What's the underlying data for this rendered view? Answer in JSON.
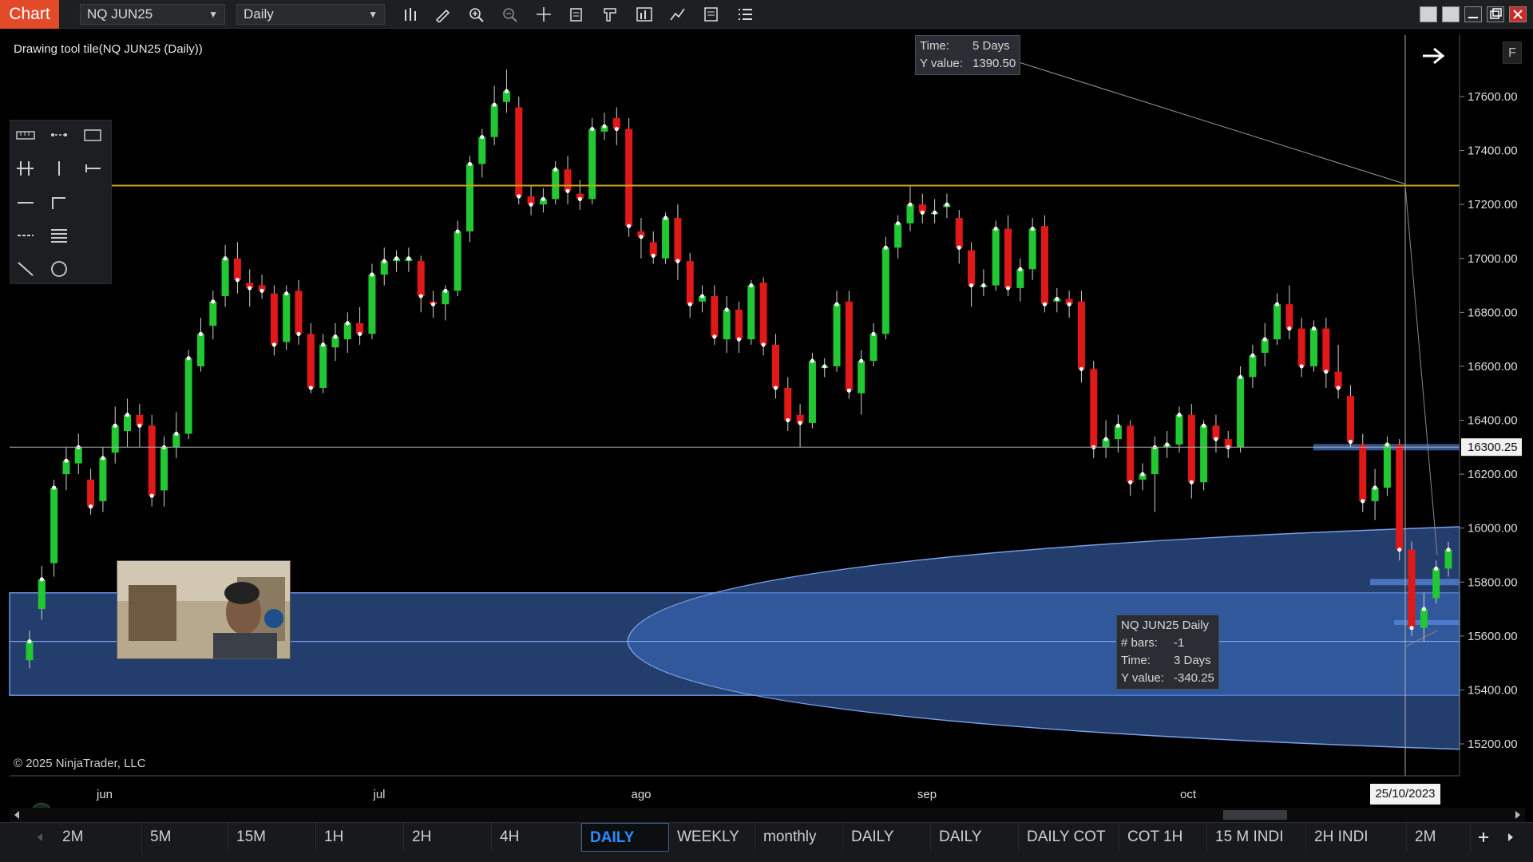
{
  "toolbar": {
    "chart_tab": "Chart",
    "instrument": "NQ JUN25",
    "interval": "Daily",
    "icons": [
      "bar-type-icon",
      "pencil-icon",
      "zoom-in-icon",
      "zoom-out-icon",
      "crosshair-icon",
      "properties-icon",
      "template-icon",
      "indicators-icon",
      "strategy-icon",
      "data-box-icon",
      "list-icon"
    ]
  },
  "chart": {
    "title": "Drawing tool tile(NQ JUN25 (Daily))",
    "copyright": "© 2025 NinjaTrader, LLC",
    "f_button": "F",
    "colors": {
      "up": "#22c832",
      "down": "#e01818",
      "horizontal_line": "#c7a620",
      "zone": "#3f6fc4",
      "crosshair": "#b0b0b0"
    },
    "price_labels": [
      "17600.00",
      "17400.00",
      "17200.00",
      "17000.00",
      "16800.00",
      "16600.00",
      "16400.00",
      "16200.00",
      "16000.00",
      "15800.00",
      "15600.00",
      "15400.00",
      "15200.00"
    ],
    "current_price": "16300.25",
    "month_labels": [
      "jun",
      "jul",
      "ago",
      "sep",
      "oct"
    ],
    "date_marker": "25/10/2023"
  },
  "chart_data": {
    "type": "candlestick",
    "ylim": [
      15100,
      17750
    ],
    "yticks": [
      17600,
      17400,
      17200,
      17000,
      16800,
      16600,
      16400,
      16200,
      16000,
      15800,
      15600,
      15400,
      15200
    ],
    "x_tick_labels": [
      "jun",
      "jul",
      "ago",
      "sep",
      "oct"
    ],
    "horizontal_line": 17270,
    "crosshair_price": 16300.25,
    "candles": [
      [
        15510,
        15580,
        15480,
        15620
      ],
      [
        15700,
        15810,
        15660,
        15860
      ],
      [
        15870,
        16150,
        15820,
        16180
      ],
      [
        16200,
        16250,
        16140,
        16300
      ],
      [
        16240,
        16300,
        16200,
        16350
      ],
      [
        16180,
        16080,
        16050,
        16220
      ],
      [
        16100,
        16260,
        16060,
        16300
      ],
      [
        16280,
        16380,
        16240,
        16450
      ],
      [
        16360,
        16420,
        16300,
        16480
      ],
      [
        16420,
        16380,
        16300,
        16460
      ],
      [
        16380,
        16120,
        16080,
        16420
      ],
      [
        16140,
        16300,
        16080,
        16340
      ],
      [
        16300,
        16350,
        16260,
        16430
      ],
      [
        16350,
        16630,
        16330,
        16660
      ],
      [
        16600,
        16720,
        16580,
        16780
      ],
      [
        16750,
        16840,
        16700,
        16880
      ],
      [
        16860,
        17000,
        16820,
        17050
      ],
      [
        17000,
        16920,
        16870,
        17060
      ],
      [
        16910,
        16890,
        16820,
        16960
      ],
      [
        16900,
        16880,
        16850,
        16940
      ],
      [
        16870,
        16680,
        16640,
        16900
      ],
      [
        16690,
        16870,
        16660,
        16900
      ],
      [
        16880,
        16720,
        16680,
        16920
      ],
      [
        16720,
        16520,
        16500,
        16760
      ],
      [
        16520,
        16680,
        16500,
        16720
      ],
      [
        16670,
        16710,
        16620,
        16760
      ],
      [
        16700,
        16760,
        16650,
        16800
      ],
      [
        16760,
        16720,
        16680,
        16820
      ],
      [
        16720,
        16940,
        16700,
        16980
      ],
      [
        16940,
        16990,
        16900,
        17040
      ],
      [
        16990,
        17000,
        16950,
        17030
      ],
      [
        16990,
        17000,
        16950,
        17040
      ],
      [
        16990,
        16860,
        16800,
        17010
      ],
      [
        16840,
        16830,
        16780,
        16880
      ],
      [
        16830,
        16880,
        16770,
        16900
      ],
      [
        16880,
        17100,
        16860,
        17140
      ],
      [
        17100,
        17350,
        17060,
        17380
      ],
      [
        17350,
        17450,
        17300,
        17480
      ],
      [
        17450,
        17570,
        17420,
        17640
      ],
      [
        17580,
        17620,
        17540,
        17700
      ],
      [
        17560,
        17230,
        17200,
        17600
      ],
      [
        17230,
        17200,
        17160,
        17270
      ],
      [
        17200,
        17220,
        17170,
        17260
      ],
      [
        17220,
        17330,
        17200,
        17360
      ],
      [
        17330,
        17250,
        17200,
        17380
      ],
      [
        17240,
        17220,
        17180,
        17290
      ],
      [
        17220,
        17480,
        17200,
        17520
      ],
      [
        17470,
        17490,
        17440,
        17540
      ],
      [
        17520,
        17480,
        17420,
        17560
      ],
      [
        17480,
        17120,
        17080,
        17520
      ],
      [
        17100,
        17080,
        17000,
        17150
      ],
      [
        17060,
        17010,
        16980,
        17100
      ],
      [
        17000,
        17150,
        16980,
        17170
      ],
      [
        17150,
        16990,
        16920,
        17200
      ],
      [
        16990,
        16830,
        16780,
        17020
      ],
      [
        16840,
        16860,
        16800,
        16900
      ],
      [
        16860,
        16710,
        16680,
        16900
      ],
      [
        16700,
        16810,
        16650,
        16860
      ],
      [
        16810,
        16700,
        16650,
        16840
      ],
      [
        16700,
        16900,
        16680,
        16920
      ],
      [
        16910,
        16680,
        16640,
        16930
      ],
      [
        16680,
        16520,
        16480,
        16720
      ],
      [
        16520,
        16400,
        16360,
        16560
      ],
      [
        16420,
        16390,
        16300,
        16460
      ],
      [
        16390,
        16620,
        16370,
        16650
      ],
      [
        16600,
        16600,
        16560,
        16630
      ],
      [
        16600,
        16830,
        16580,
        16880
      ],
      [
        16840,
        16510,
        16480,
        16880
      ],
      [
        16500,
        16620,
        16420,
        16660
      ],
      [
        16620,
        16720,
        16600,
        16760
      ],
      [
        16720,
        17040,
        16700,
        17080
      ],
      [
        17040,
        17130,
        17000,
        17160
      ],
      [
        17130,
        17200,
        17100,
        17270
      ],
      [
        17200,
        17170,
        17130,
        17240
      ],
      [
        17170,
        17170,
        17130,
        17220
      ],
      [
        17190,
        17200,
        17150,
        17240
      ],
      [
        17150,
        17040,
        16980,
        17180
      ],
      [
        17030,
        16900,
        16820,
        17060
      ],
      [
        16900,
        16900,
        16860,
        16960
      ],
      [
        16900,
        17110,
        16880,
        17140
      ],
      [
        17110,
        16890,
        16860,
        17160
      ],
      [
        16890,
        16960,
        16840,
        17000
      ],
      [
        16960,
        17110,
        16920,
        17150
      ],
      [
        17120,
        16830,
        16800,
        17160
      ],
      [
        16840,
        16850,
        16800,
        16890
      ],
      [
        16850,
        16830,
        16780,
        16880
      ],
      [
        16840,
        16590,
        16540,
        16880
      ],
      [
        16590,
        16300,
        16260,
        16620
      ],
      [
        16300,
        16330,
        16260,
        16400
      ],
      [
        16330,
        16380,
        16280,
        16420
      ],
      [
        16380,
        16170,
        16120,
        16400
      ],
      [
        16180,
        16200,
        16140,
        16240
      ],
      [
        16200,
        16300,
        16060,
        16340
      ],
      [
        16300,
        16310,
        16260,
        16360
      ],
      [
        16310,
        16420,
        16280,
        16450
      ],
      [
        16420,
        16170,
        16110,
        16460
      ],
      [
        16170,
        16380,
        16140,
        16400
      ],
      [
        16380,
        16330,
        16280,
        16420
      ],
      [
        16330,
        16300,
        16260,
        16360
      ],
      [
        16300,
        16560,
        16280,
        16600
      ],
      [
        16560,
        16640,
        16520,
        16680
      ],
      [
        16650,
        16700,
        16600,
        16760
      ],
      [
        16700,
        16830,
        16680,
        16870
      ],
      [
        16830,
        16740,
        16700,
        16900
      ],
      [
        16740,
        16600,
        16560,
        16780
      ],
      [
        16600,
        16740,
        16580,
        16770
      ],
      [
        16740,
        16580,
        16520,
        16780
      ],
      [
        16580,
        16520,
        16480,
        16680
      ],
      [
        16490,
        16320,
        16300,
        16530
      ],
      [
        16310,
        16100,
        16060,
        16350
      ],
      [
        16100,
        16150,
        16030,
        16220
      ],
      [
        16150,
        16310,
        16120,
        16340
      ],
      [
        16310,
        15920,
        15880,
        16330
      ],
      [
        15920,
        15630,
        15600,
        15950
      ],
      [
        15630,
        15700,
        15580,
        15760
      ],
      [
        15740,
        15850,
        15720,
        15880
      ],
      [
        15850,
        15920,
        15820,
        15950
      ]
    ]
  },
  "tooltips": {
    "top": {
      "time_label": "Time:",
      "time_value": "5 Days",
      "y_label": "Y value:",
      "y_value": "1390.50"
    },
    "bottom": {
      "title": "NQ JUN25 Daily",
      "bars_label": "# bars:",
      "bars_value": "-1",
      "time_label": "Time:",
      "time_value": "3 Days",
      "y_label": "Y value:",
      "y_value": "-340.25"
    }
  },
  "drawing_tools": [
    "ruler-icon",
    "risk-reward-icon",
    "rectangle-icon",
    "fibonacci-icon",
    "vertical-line-icon",
    "horizontal-ray-icon",
    "horizontal-line-icon",
    "extended-line-icon",
    "ray-icon",
    "lines-icon",
    "trend-line-icon",
    "ellipse-icon"
  ],
  "bottom_tabs": [
    "2M",
    "5M",
    "15M",
    "1H",
    "2H",
    "4H",
    "DAILY",
    "WEEKLY",
    "monthly",
    "DAILY",
    "DAILY",
    "DAILY COT",
    "COT 1H",
    "15 M INDI",
    "2H INDI",
    "2M"
  ],
  "active_tab_index": 6
}
